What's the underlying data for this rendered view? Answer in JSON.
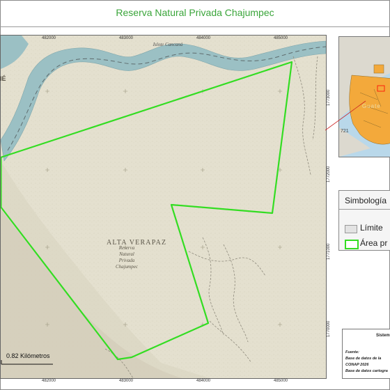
{
  "title": "Reserva Natural Privada Chajumpec",
  "map": {
    "x_ticks": [
      "482000",
      "483000",
      "484000",
      "485000"
    ],
    "y_ticks": [
      "1773000",
      "1772000",
      "1771000",
      "1770000"
    ],
    "department_label": "ALTA VERAPAZ",
    "reserve_label": "Reserva Natural Privada Chajumpec",
    "island_label": "Islote Cancaná",
    "edge_label": "IÉ",
    "scale_label": "0.82 Kilómetros",
    "boundary_color": "#33dd22",
    "river_color": "#9bc0c4"
  },
  "inset": {
    "country_label": "Guate",
    "number_label": "721"
  },
  "legend": {
    "title": "Simbología",
    "items": [
      "Límite",
      "Área pr"
    ]
  },
  "source": {
    "system": "Sistem",
    "lines": [
      "Fuente:",
      "Base de datos de la",
      "CONAP 2026",
      "Base de datos cartogra"
    ]
  }
}
